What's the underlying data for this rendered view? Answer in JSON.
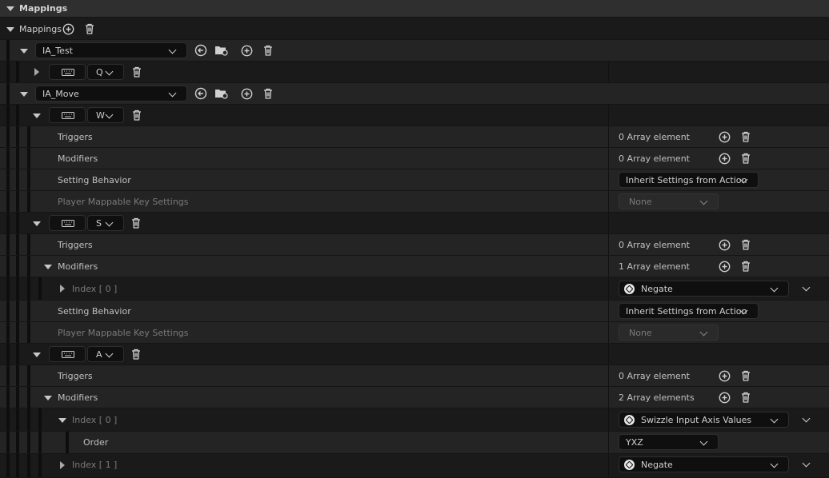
{
  "section_title": "Mappings",
  "mappings_label": "Mappings",
  "actions": [
    {
      "name": "IA_Test",
      "keys": [
        {
          "key": "Q"
        }
      ]
    },
    {
      "name": "IA_Move",
      "keys": [
        {
          "key": "W"
        },
        {
          "key": "S"
        },
        {
          "key": "A"
        }
      ]
    }
  ],
  "props": {
    "triggers": "Triggers",
    "modifiers": "Modifiers",
    "setting_behavior": "Setting Behavior",
    "player_mappable": "Player Mappable Key Settings",
    "order": "Order"
  },
  "values": {
    "zero_array": "0 Array element",
    "one_array": "1 Array element",
    "two_array": "2 Array elements",
    "inherit": "Inherit Settings from Action",
    "none": "None",
    "negate": "Negate",
    "swizzle": "Swizzle Input Axis Values",
    "yxz": "YXZ"
  },
  "index_labels": {
    "i0": "Index [ 0 ]",
    "i1": "Index [ 1 ]"
  }
}
